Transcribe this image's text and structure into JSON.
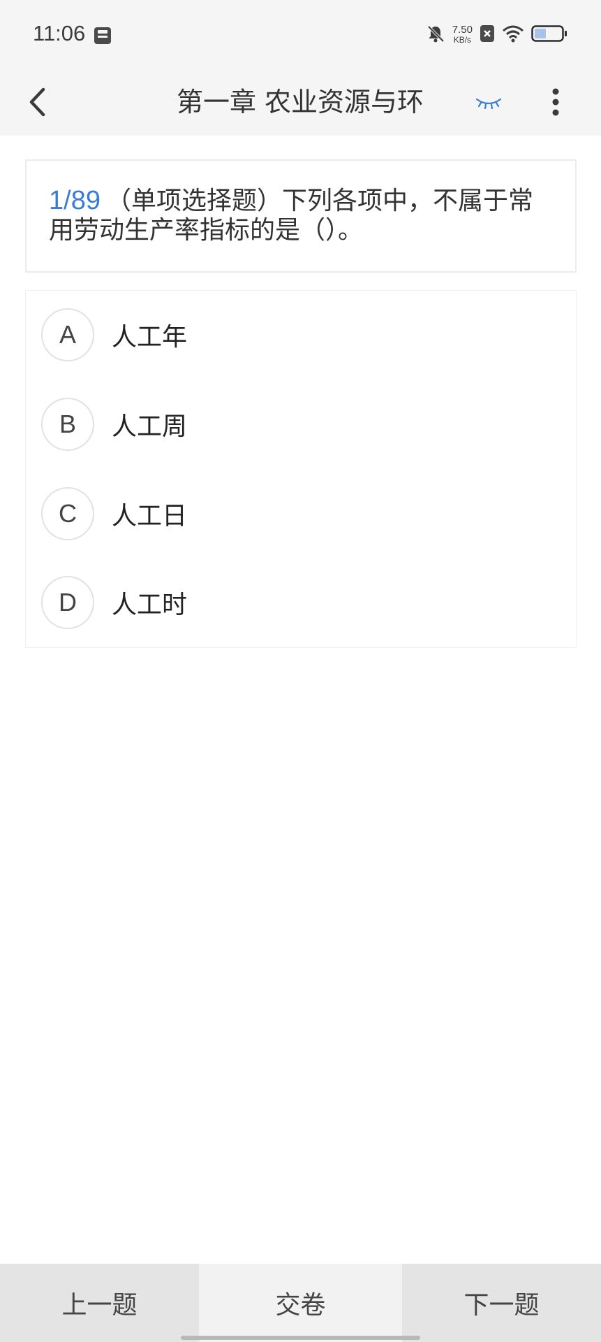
{
  "status_bar": {
    "time": "11:06",
    "net_speed_value": "7.50",
    "net_speed_unit": "KB/s",
    "battery_level": 0.4,
    "icons": [
      "save-icon",
      "mute-bell-icon",
      "x-box-icon",
      "wifi-icon",
      "battery-icon"
    ]
  },
  "header": {
    "title": "第一章 农业资源与环",
    "back_icon": "chevron-left-icon",
    "eye_icon": "eye-closed-icon",
    "more_icon": "more-vertical-icon"
  },
  "question": {
    "index": "1/89",
    "text": "（单项选择题）下列各项中，不属于常用劳动生产率指标的是（）。"
  },
  "options": [
    {
      "letter": "A",
      "text": "人工年"
    },
    {
      "letter": "B",
      "text": "人工周"
    },
    {
      "letter": "C",
      "text": "人工日"
    },
    {
      "letter": "D",
      "text": "人工时"
    }
  ],
  "bottom": {
    "prev_label": "上一题",
    "submit_label": "交卷",
    "next_label": "下一题"
  },
  "colors": {
    "accent": "#3a7bd5",
    "bar_bg": "#f5f5f5",
    "bottom_side": "#e4e4e4",
    "bottom_center": "#f2f2f2"
  }
}
